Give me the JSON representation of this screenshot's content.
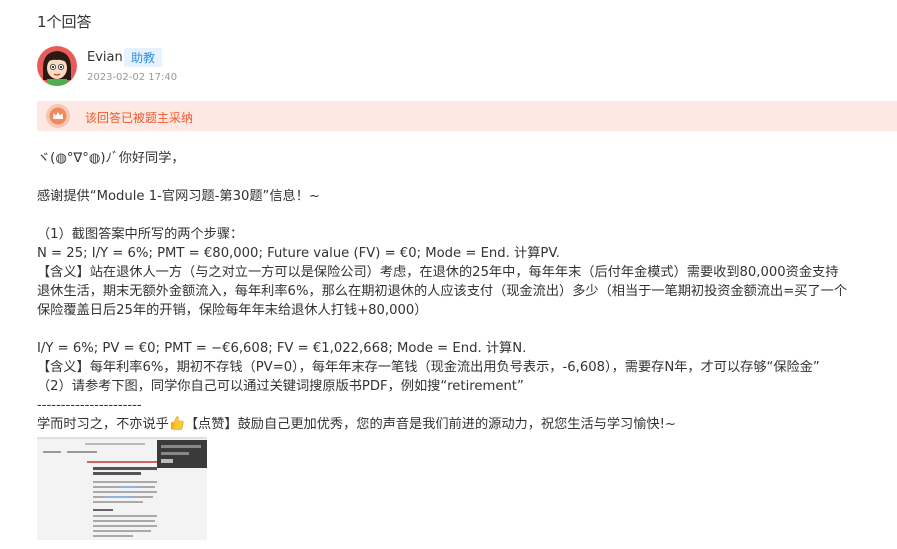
{
  "answer_count": "1个回答",
  "author": {
    "name": "Evian",
    "role": "助教",
    "date": "2023-02-02 17:40"
  },
  "adopted_notice": "该回答已被题主采纳",
  "body": {
    "greeting": "ヾ(◍°∇°◍)ﾉﾞ你好同学，",
    "thanks": "感谢提供“Module 1-官网习题-第30题”信息！~",
    "section1_title": "（1）截图答案中所写的两个步骤：",
    "step1": "N = 25; I/Y = 6%; PMT = €80,000; Future value (FV) = €0; Mode = End. 计算PV.",
    "meaning1_line1": "【含义】站在退休人一方（与之对立一方可以是保险公司）考虑，在退休的25年中，每年年末（后付年金模式）需要收到80,000资金支持",
    "meaning1_line2": "退休生活，期末无额外金额流入，每年利率6%，那么在期初退休的人应该支付（现金流出）多少（相当于一笔期初投资金额流出=买了一个",
    "meaning1_line3": "保险覆盖日后25年的开销，保险每年年末给退休人打钱+80,000）",
    "step2": "I/Y = 6%; PV = €0; PMT = −€6,608; FV = €1,022,668; Mode = End. 计算N.",
    "meaning2": "【含义】每年利率6%，期初不存钱（PV=0），每年年末存一笔钱（现金流出用负号表示，-6,608），需要存N年，才可以存够“保险金”",
    "section2": "（2）请参考下图，同学你自己可以通过关键词搜原版书PDF，例如搜“retirement”",
    "divider": "----------------------",
    "closing_before": "学而时习之，不亦说乎",
    "closing_after": "【点赞】鼓励自己更加优秀，您的声音是我们前进的源动力，祝您生活与学习愉快!~"
  },
  "colors": {
    "accent_blue": "#2f8fe8",
    "adopted_bg": "#fde8e4",
    "adopted_text": "#ee5a2c"
  }
}
